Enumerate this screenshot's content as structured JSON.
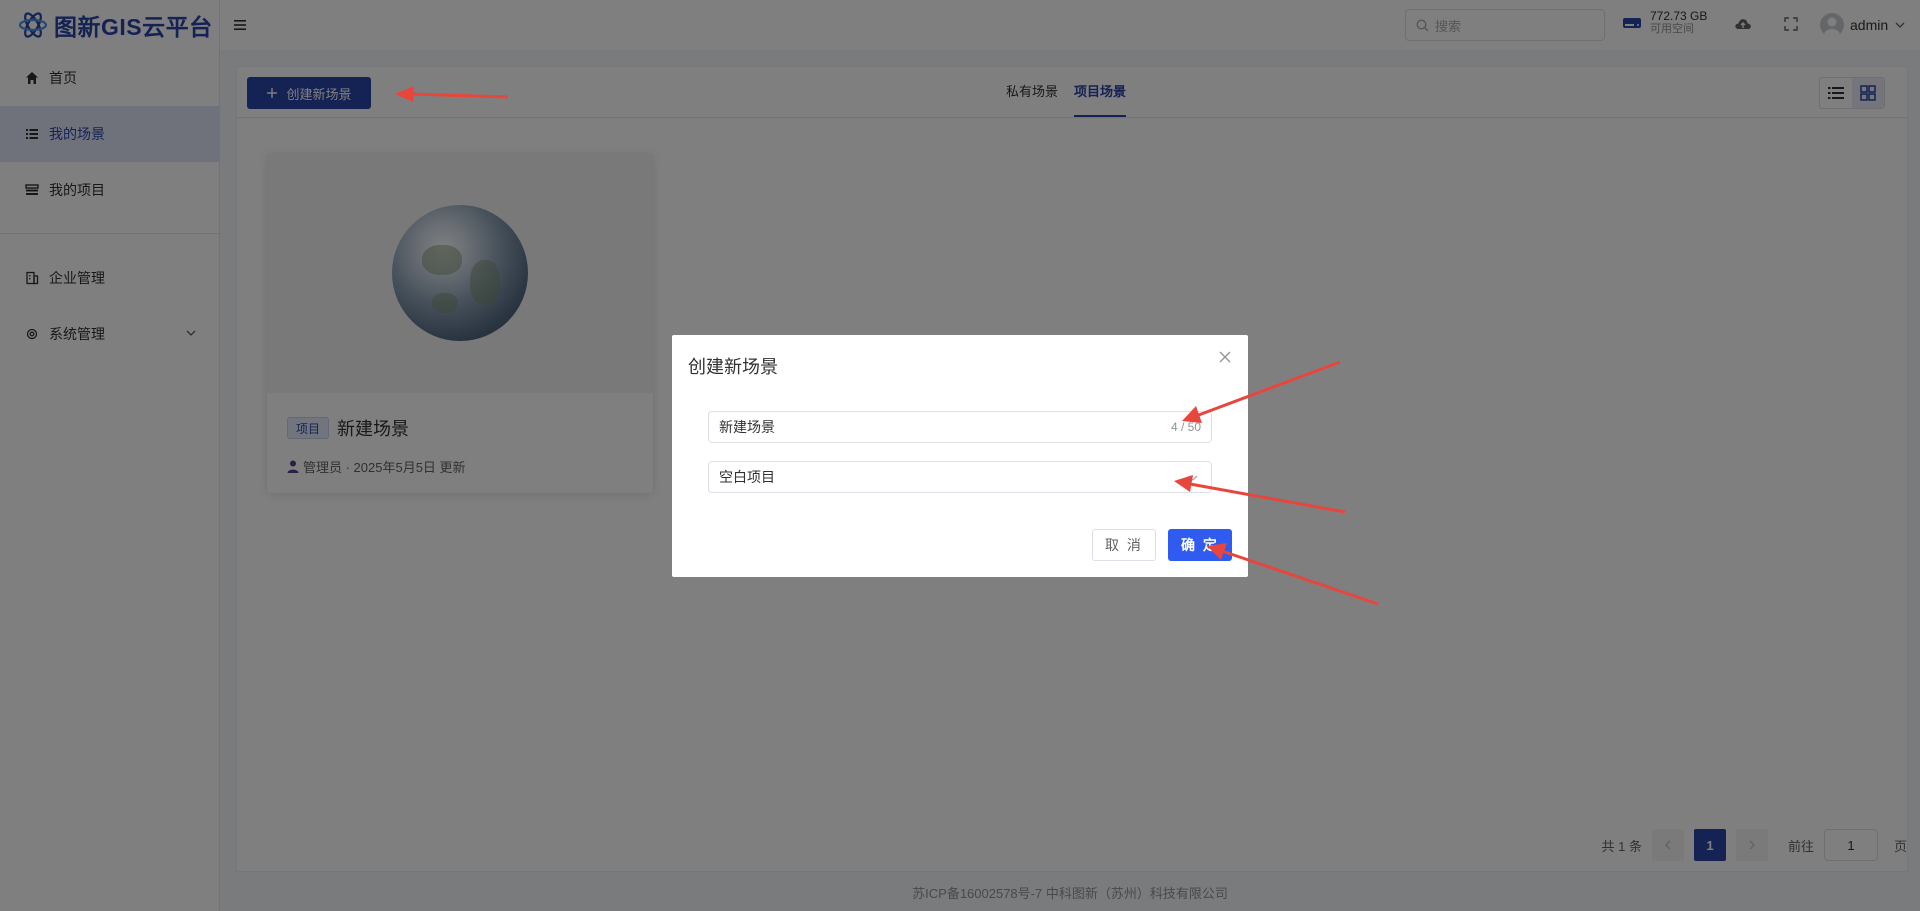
{
  "app": {
    "title": "图新GIS云平台"
  },
  "sidebar": {
    "items": [
      {
        "label": "首页",
        "icon": "home-icon"
      },
      {
        "label": "我的场景",
        "icon": "list-icon",
        "active": true
      },
      {
        "label": "我的项目",
        "icon": "project-icon"
      },
      {
        "label": "企业管理",
        "icon": "building-icon"
      },
      {
        "label": "系统管理",
        "icon": "gear-icon"
      }
    ]
  },
  "header": {
    "search_placeholder": "搜索",
    "storage_size": "772.73 GB",
    "storage_label": "可用空间",
    "username": "admin"
  },
  "toolbar": {
    "create_label": "创建新场景"
  },
  "tabs": [
    {
      "label": "私有场景",
      "active": false
    },
    {
      "label": "项目场景",
      "active": true
    }
  ],
  "card": {
    "tag": "项目",
    "title": "新建场景",
    "meta": "管理员 · 2025年5月5日 更新"
  },
  "pagination": {
    "total": "共 1 条",
    "current": "1",
    "goto_label": "前往",
    "goto_value": "1",
    "page_suffix": "页"
  },
  "footer": {
    "text": "苏ICP备16002578号-7 中科图新（苏州）科技有限公司"
  },
  "dialog": {
    "title": "创建新场景",
    "name_value": "新建场景",
    "name_count": "4 / 50",
    "project_value": "空白项目",
    "cancel_label": "取 消",
    "ok_label": "确 定"
  },
  "colors": {
    "brand": "#2a45a8",
    "primary_button": "#2f5bf0",
    "annotation_arrow": "#e8463c"
  }
}
